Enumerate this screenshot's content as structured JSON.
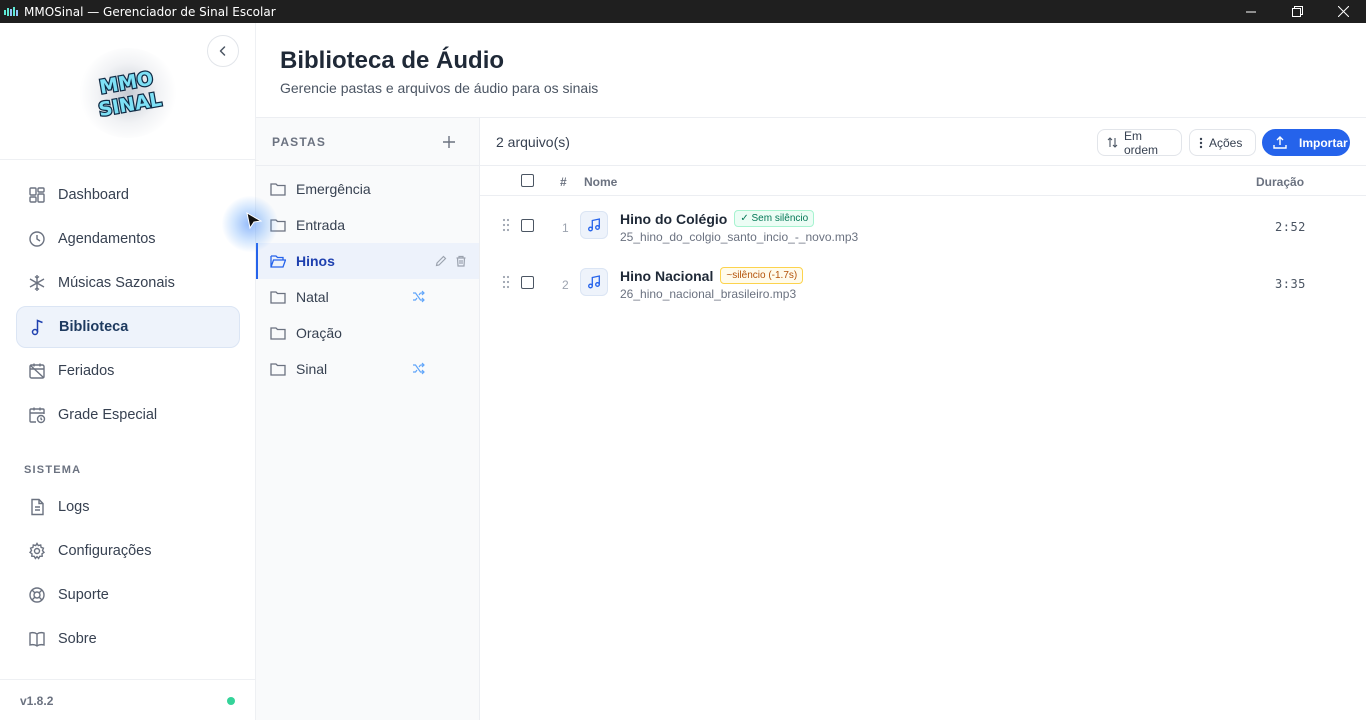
{
  "window": {
    "title": "MMOSinal — Gerenciador de Sinal Escolar",
    "icon": "app-logo-icon"
  },
  "sidebar": {
    "logo_text": "MMO SINAL",
    "collapse_icon": "chevron-left-icon",
    "nav": [
      {
        "label": "Dashboard",
        "icon": "dashboard-icon",
        "active": false
      },
      {
        "label": "Agendamentos",
        "icon": "clock-icon",
        "active": false
      },
      {
        "label": "Músicas Sazonais",
        "icon": "snowflake-icon",
        "active": false
      },
      {
        "label": "Biblioteca",
        "icon": "music-note-icon",
        "active": true
      },
      {
        "label": "Feriados",
        "icon": "calendar-off-icon",
        "active": false
      },
      {
        "label": "Grade Especial",
        "icon": "calendar-clock-icon",
        "active": false
      }
    ],
    "section_label": "SISTEMA",
    "system_nav": [
      {
        "label": "Logs",
        "icon": "file-text-icon"
      },
      {
        "label": "Configurações",
        "icon": "gear-icon"
      },
      {
        "label": "Suporte",
        "icon": "lifebuoy-icon"
      },
      {
        "label": "Sobre",
        "icon": "book-icon"
      }
    ],
    "version": "v1.8.2",
    "status_color": "#34d399"
  },
  "header": {
    "title": "Biblioteca de Áudio",
    "subtitle": "Gerencie pastas e arquivos de áudio para os sinais"
  },
  "folders": {
    "heading": "PASTAS",
    "items": [
      {
        "name": "Emergência",
        "active": false,
        "shuffle": false
      },
      {
        "name": "Entrada",
        "active": false,
        "shuffle": false
      },
      {
        "name": "Hinos",
        "active": true,
        "shuffle": false
      },
      {
        "name": "Natal",
        "active": false,
        "shuffle": true
      },
      {
        "name": "Oração",
        "active": false,
        "shuffle": false
      },
      {
        "name": "Sinal",
        "active": false,
        "shuffle": true
      }
    ]
  },
  "files": {
    "count_label": "2 arquivo(s)",
    "order_label": "Em ordem",
    "actions_label": "Ações",
    "import_label": "Importar",
    "columns": {
      "num": "#",
      "name": "Nome",
      "duration": "Duração"
    },
    "rows": [
      {
        "num": "1",
        "title": "Hino do Colégio",
        "badge": "✓ Sem silêncio",
        "badge_type": "ok",
        "file": "25_hino_do_colgio_santo_incio_-_novo.mp3",
        "duration": "2:52"
      },
      {
        "num": "2",
        "title": "Hino Nacional",
        "badge": "~silêncio (-1.7s)",
        "badge_type": "warn",
        "file": "26_hino_nacional_brasileiro.mp3",
        "duration": "3:35"
      }
    ]
  },
  "colors": {
    "accent": "#2563eb",
    "titlebar": "#1f1f1f",
    "ok": "#047857",
    "warn": "#b45309"
  }
}
